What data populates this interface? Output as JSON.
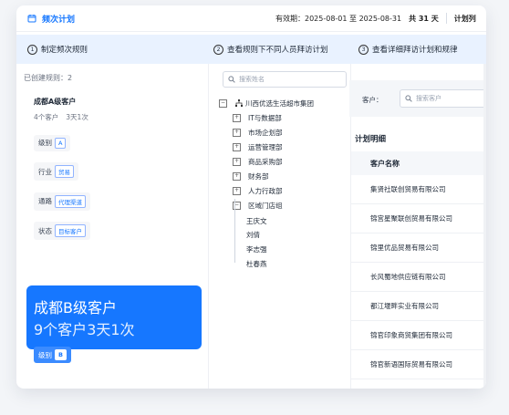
{
  "header": {
    "title": "频次计划",
    "validity": "有效期：2025-08-01 至 2025-08-31",
    "total": "共 31 天",
    "plan_label": "计划列"
  },
  "steps": [
    {
      "num": "1",
      "label": "制定频次规则"
    },
    {
      "num": "2",
      "label": "查看规则下不同人员拜访计划"
    },
    {
      "num": "3",
      "label": "查看详细拜访计划和规律"
    }
  ],
  "rules": {
    "count_label": "已创建规则：2",
    "rule_a": {
      "name": "成都A级客户",
      "customers": "4个客户",
      "frequency": "3天1次",
      "attrs": [
        {
          "label": "级别",
          "value": "A"
        },
        {
          "label": "行业",
          "value": "贸易"
        },
        {
          "label": "通路",
          "value": "代理渠道"
        },
        {
          "label": "状态",
          "value": "目标客户"
        }
      ]
    },
    "rule_b": {
      "name": "成都B级客户",
      "customers": "9个客户",
      "frequency": "3天1次",
      "attr_label": "级别",
      "attr_value": "B"
    }
  },
  "org": {
    "search_placeholder": "搜索姓名",
    "root": "川西优选生活超市集团",
    "departments": [
      "IT与数据部",
      "市场企划部",
      "运营管理部",
      "商品采购部",
      "财务部",
      "人力行政部",
      "区域门店组"
    ],
    "people": [
      "王庆文",
      "刘倩",
      "李志强",
      "杜春燕"
    ]
  },
  "detail": {
    "customer_label": "客户：",
    "search_placeholder": "搜索客户",
    "section_title": "计划明细",
    "column_header": "客户名称",
    "rows": [
      "集贤社联创贸易有限公司",
      "锦宫星聚联创贸易有限公司",
      "锦里优品贸易有限公司",
      "长风蜀地供应链有限公司",
      "都江堰畔实业有限公司",
      "锦官印象商贸集团有限公司",
      "锦官新语国际贸易有限公司"
    ]
  },
  "colors": {
    "accent": "#1677ff",
    "step_bg": "#e9f2ff"
  },
  "icons": [
    "calendar-icon",
    "search-icon",
    "org-root-icon",
    "expand-icon",
    "collapse-icon"
  ]
}
